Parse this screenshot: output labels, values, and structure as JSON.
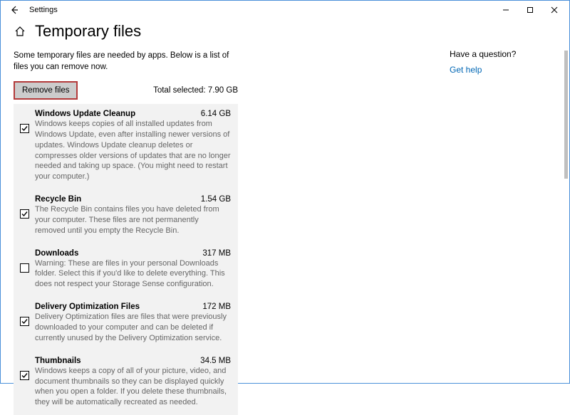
{
  "window": {
    "app_title": "Settings"
  },
  "page": {
    "title": "Temporary files",
    "intro": "Some temporary files are needed by apps. Below is a list of files you can remove now.",
    "remove_label": "Remove files",
    "total_selected_label": "Total selected: 7.90 GB"
  },
  "items": [
    {
      "title": "Windows Update Cleanup",
      "size": "6.14 GB",
      "desc": "Windows keeps copies of all installed updates from Windows Update, even after installing newer versions of updates. Windows Update cleanup deletes or compresses older versions of updates that are no longer needed and taking up space. (You might need to restart your computer.)",
      "checked": true
    },
    {
      "title": "Recycle Bin",
      "size": "1.54 GB",
      "desc": "The Recycle Bin contains files you have deleted from your computer. These files are not permanently removed until you empty the Recycle Bin.",
      "checked": true
    },
    {
      "title": "Downloads",
      "size": "317 MB",
      "desc": "Warning: These are files in your personal Downloads folder. Select this if you'd like to delete everything. This does not respect your Storage Sense configuration.",
      "checked": false
    },
    {
      "title": "Delivery Optimization Files",
      "size": "172 MB",
      "desc": "Delivery Optimization files are files that were previously downloaded to your computer and can be deleted if currently unused by the Delivery Optimization service.",
      "checked": true
    },
    {
      "title": "Thumbnails",
      "size": "34.5 MB",
      "desc": "Windows keeps a copy of all of your picture, video, and document thumbnails so they can be displayed quickly when you open a folder. If you delete these thumbnails, they will be automatically recreated as needed.",
      "checked": true
    }
  ],
  "sidebar": {
    "question": "Have a question?",
    "help_link": "Get help"
  }
}
